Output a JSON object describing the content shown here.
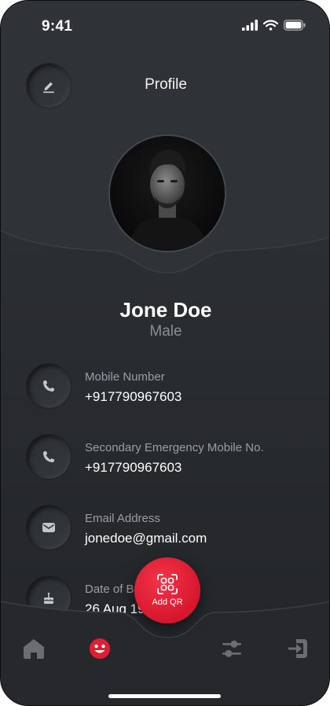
{
  "status_bar": {
    "time": "9:41"
  },
  "header": {
    "title": "Profile"
  },
  "profile": {
    "name": "Jone Doe",
    "gender": "Male"
  },
  "details": [
    {
      "label": "Mobile Number",
      "value": "+917790967603",
      "icon": "phone-icon"
    },
    {
      "label": "Secondary Emergency Mobile No.",
      "value": "+917790967603",
      "icon": "phone-icon"
    },
    {
      "label": "Email Address",
      "value": "jonedoe@gmail.com",
      "icon": "mail-icon"
    },
    {
      "label": "Date of B",
      "value": "26 Aug 19",
      "icon": "cake-icon"
    }
  ],
  "fab": {
    "label": "Add QR",
    "icon": "qr-scan-icon",
    "color": "#e01e33"
  },
  "bottom_nav": [
    {
      "icon": "home-icon",
      "active": false
    },
    {
      "icon": "smiley-profile-icon",
      "active": true,
      "color": "#e01e33"
    },
    {
      "icon": "sliders-icon",
      "active": false
    },
    {
      "icon": "logout-icon",
      "active": false
    }
  ]
}
